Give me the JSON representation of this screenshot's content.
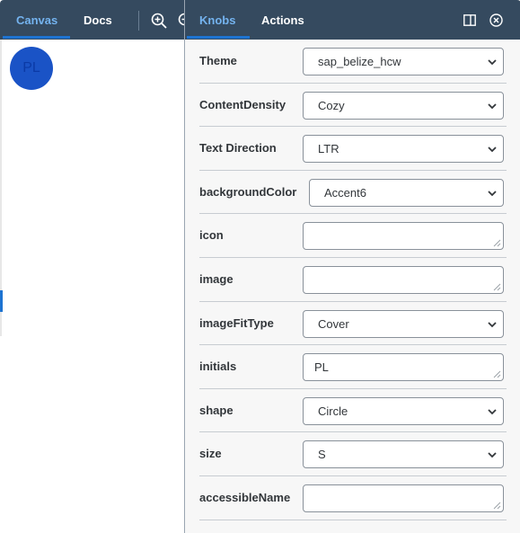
{
  "left_panel": {
    "tabs": [
      {
        "label": "Canvas",
        "active": true
      },
      {
        "label": "Docs",
        "active": false
      }
    ],
    "toolbar_icons": [
      "zoom-in-icon",
      "zoom-out-icon"
    ],
    "avatar": {
      "initials": "PL",
      "background": "#1a53c6",
      "shape": "circle"
    }
  },
  "right_panel": {
    "tabs": [
      {
        "label": "Knobs",
        "active": true
      },
      {
        "label": "Actions",
        "active": false
      }
    ],
    "toolbar_icons": [
      "panel-layout-icon",
      "close-icon"
    ],
    "knobs": [
      {
        "label": "Theme",
        "type": "select",
        "value": "sap_belize_hcw"
      },
      {
        "label": "ContentDensity",
        "type": "select",
        "value": "Cozy"
      },
      {
        "label": "Text Direction",
        "type": "select",
        "value": "LTR"
      },
      {
        "label": "backgroundColor",
        "type": "select",
        "value": "Accent6"
      },
      {
        "label": "icon",
        "type": "text",
        "value": ""
      },
      {
        "label": "image",
        "type": "text",
        "value": ""
      },
      {
        "label": "imageFitType",
        "type": "select",
        "value": "Cover"
      },
      {
        "label": "initials",
        "type": "text",
        "value": "PL"
      },
      {
        "label": "shape",
        "type": "select",
        "value": "Circle"
      },
      {
        "label": "size",
        "type": "select",
        "value": "S"
      },
      {
        "label": "accessibleName",
        "type": "text",
        "value": ""
      }
    ]
  },
  "colors": {
    "header_bg": "#354a5f",
    "accent": "#1d73d1",
    "active_tab_text": "#74b3ef"
  }
}
